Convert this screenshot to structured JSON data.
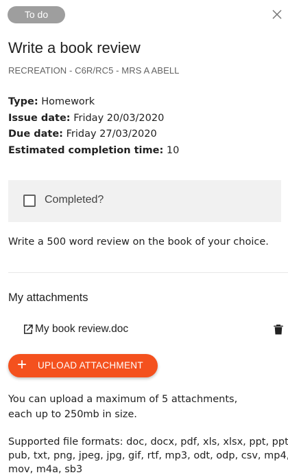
{
  "header": {
    "status": "To do",
    "close_icon": "close-icon"
  },
  "task": {
    "title": "Write a book review",
    "subtitle": "RECREATION - C6R/RC5 - MRS A ABELL"
  },
  "details": {
    "type_label": "Type:",
    "type_value": "Homework",
    "issue_label": "Issue date:",
    "issue_value": "Friday 20/03/2020",
    "due_label": "Due date:",
    "due_value": "Friday 27/03/2020",
    "estimate_label": "Estimated completion time:",
    "estimate_value": "10"
  },
  "completed": {
    "label": "Completed?",
    "checked": false
  },
  "description": "Write a 500 word review on the book of your choice.",
  "attachments": {
    "heading": "My attachments",
    "items": [
      {
        "name": "My book review.doc",
        "open_icon": "open-in-new-icon",
        "delete_icon": "trash-icon"
      }
    ],
    "upload_label": "UPLOAD ATTACHMENT",
    "limits_line1": "You can upload a maximum of 5 attachments,",
    "limits_line2": "each up to 250mb in size.",
    "formats_line1": "Supported file formats: doc, docx, pdf, xls, xlsx, ppt, pptx,",
    "formats_line2": "pub, txt, png, jpeg, jpg, gif, rtf, mp3, odt, odp, csv, mp4,",
    "formats_line3": "mov, m4a, sb3"
  },
  "colors": {
    "status_chip": "#9e9e9e",
    "upload_button": "#f4511e",
    "completed_bg": "#f1f1f1"
  }
}
